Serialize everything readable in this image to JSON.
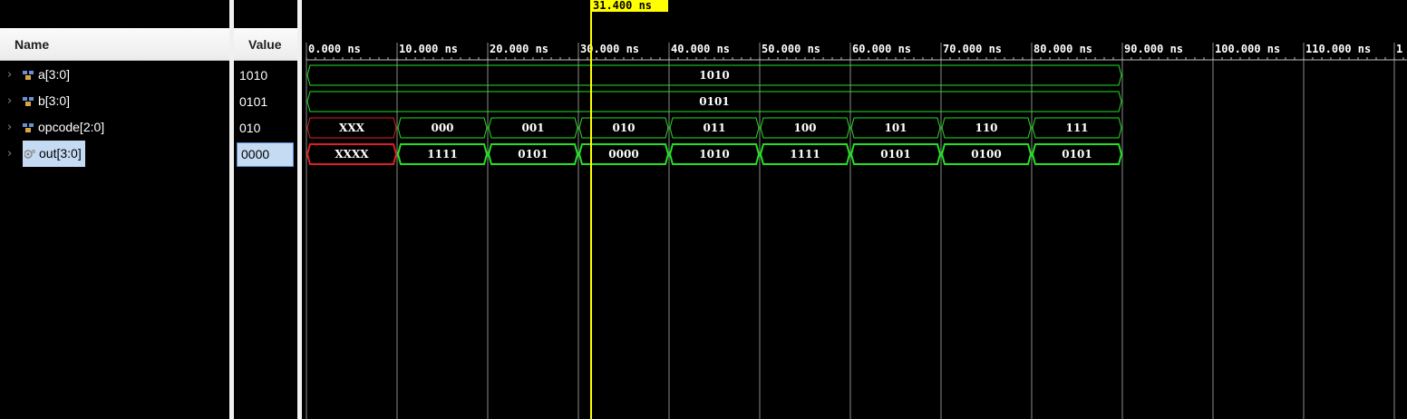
{
  "columns": {
    "name": "Name",
    "value": "Value"
  },
  "cursor": {
    "label": "31.400 ns",
    "time_ns": 31.4
  },
  "timeline": {
    "unit": "ns",
    "ticks": [
      {
        "t": 0,
        "label": "0.000 ns"
      },
      {
        "t": 10,
        "label": "10.000 ns"
      },
      {
        "t": 20,
        "label": "20.000 ns"
      },
      {
        "t": 30,
        "label": "30.000 ns"
      },
      {
        "t": 40,
        "label": "40.000 ns"
      },
      {
        "t": 50,
        "label": "50.000 ns"
      },
      {
        "t": 60,
        "label": "60.000 ns"
      },
      {
        "t": 70,
        "label": "70.000 ns"
      },
      {
        "t": 80,
        "label": "80.000 ns"
      },
      {
        "t": 90,
        "label": "90.000 ns"
      },
      {
        "t": 100,
        "label": "100.000 ns"
      },
      {
        "t": 110,
        "label": "110.000 ns"
      },
      {
        "t": 120,
        "label": "1"
      }
    ],
    "sim_end_ns": 90
  },
  "colors": {
    "bus": "#22e022",
    "undefined": "#e02020",
    "cursor": "#ffff00",
    "grid": "#8c8c8c",
    "selection": "#c5dbf4"
  },
  "signals": [
    {
      "name": "a[3:0]",
      "value": "1010",
      "kind": "input",
      "selected": false,
      "segments": [
        {
          "start": 0,
          "end": 90,
          "value": "1010",
          "x": false
        }
      ]
    },
    {
      "name": "b[3:0]",
      "value": "0101",
      "kind": "input",
      "selected": false,
      "segments": [
        {
          "start": 0,
          "end": 90,
          "value": "0101",
          "x": false
        }
      ]
    },
    {
      "name": "opcode[2:0]",
      "value": "010",
      "kind": "input",
      "selected": false,
      "segments": [
        {
          "start": 0,
          "end": 10,
          "value": "XXX",
          "x": true
        },
        {
          "start": 10,
          "end": 20,
          "value": "000",
          "x": false
        },
        {
          "start": 20,
          "end": 30,
          "value": "001",
          "x": false
        },
        {
          "start": 30,
          "end": 40,
          "value": "010",
          "x": false
        },
        {
          "start": 40,
          "end": 50,
          "value": "011",
          "x": false
        },
        {
          "start": 50,
          "end": 60,
          "value": "100",
          "x": false
        },
        {
          "start": 60,
          "end": 70,
          "value": "101",
          "x": false
        },
        {
          "start": 70,
          "end": 80,
          "value": "110",
          "x": false
        },
        {
          "start": 80,
          "end": 90,
          "value": "111",
          "x": false
        }
      ]
    },
    {
      "name": "out[3:0]",
      "value": "0000",
      "kind": "output",
      "selected": true,
      "segments": [
        {
          "start": 0,
          "end": 10,
          "value": "XXXX",
          "x": true
        },
        {
          "start": 10,
          "end": 20,
          "value": "1111",
          "x": false
        },
        {
          "start": 20,
          "end": 30,
          "value": "0101",
          "x": false
        },
        {
          "start": 30,
          "end": 40,
          "value": "0000",
          "x": false
        },
        {
          "start": 40,
          "end": 50,
          "value": "1010",
          "x": false
        },
        {
          "start": 50,
          "end": 60,
          "value": "1111",
          "x": false
        },
        {
          "start": 60,
          "end": 70,
          "value": "0101",
          "x": false
        },
        {
          "start": 70,
          "end": 80,
          "value": "0100",
          "x": false
        },
        {
          "start": 80,
          "end": 90,
          "value": "0101",
          "x": false
        }
      ]
    }
  ]
}
